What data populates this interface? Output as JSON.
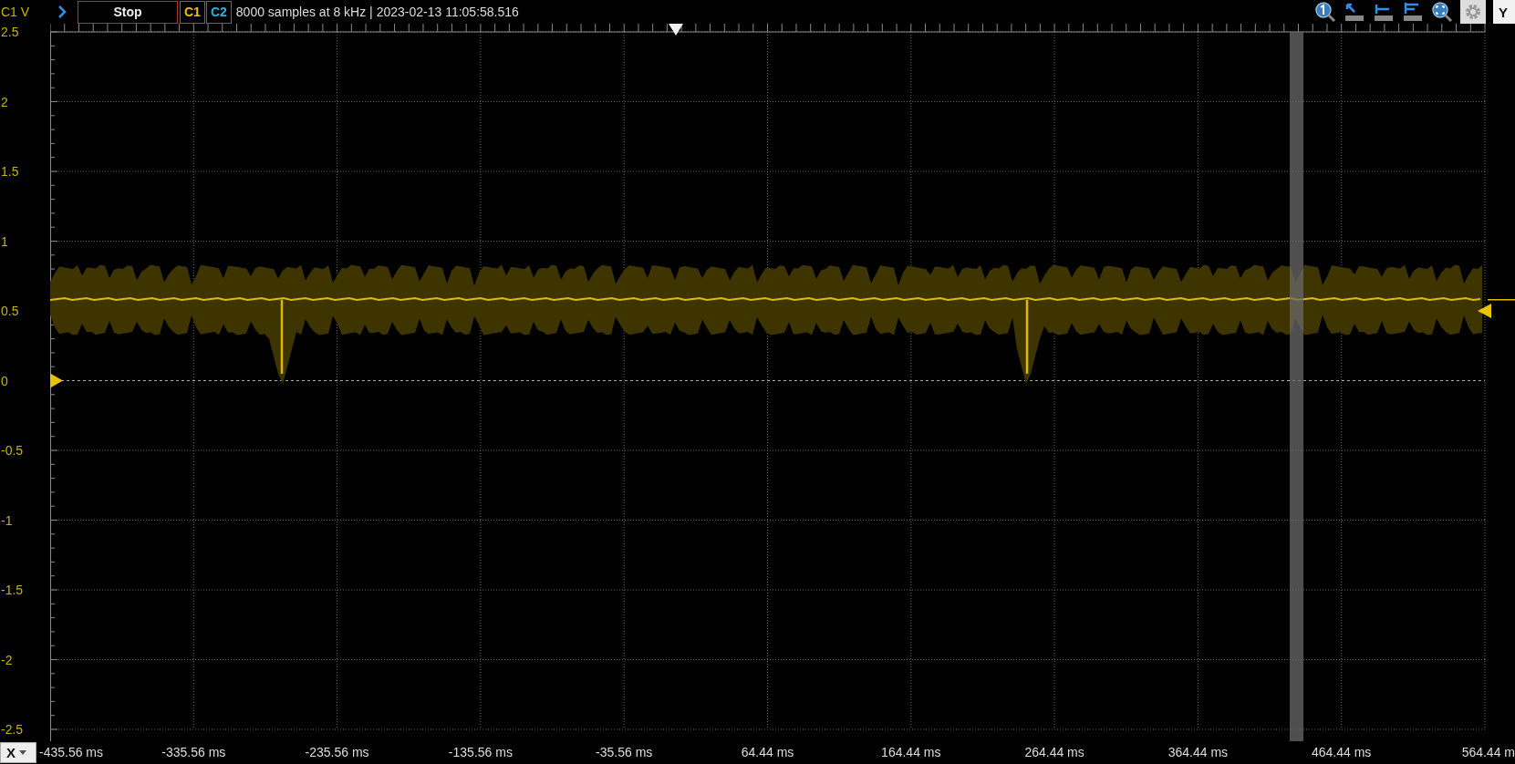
{
  "toolbar": {
    "units_label": "C1 V",
    "run_button": "Stop",
    "channels": [
      {
        "label": "C1",
        "color": "#e8c400"
      },
      {
        "label": "C2",
        "color": "#2ab4e0"
      }
    ],
    "info": "8000 samples at 8 kHz | 2023-02-13 11:05:58.516",
    "y_button": "Y"
  },
  "y_axis": {
    "labels": [
      "2.5",
      "2",
      "1.5",
      "1",
      "0.5",
      "0",
      "-0.5",
      "-1",
      "-1.5",
      "-2",
      "-2.5"
    ]
  },
  "x_axis": {
    "button": "X",
    "labels": [
      "-435.56 ms",
      "-335.56 ms",
      "-235.56 ms",
      "-135.56 ms",
      "-35.56 ms",
      "64.44 ms",
      "164.44 ms",
      "264.44 ms",
      "364.44 ms",
      "464.44 ms",
      "564.44 m"
    ]
  }
}
